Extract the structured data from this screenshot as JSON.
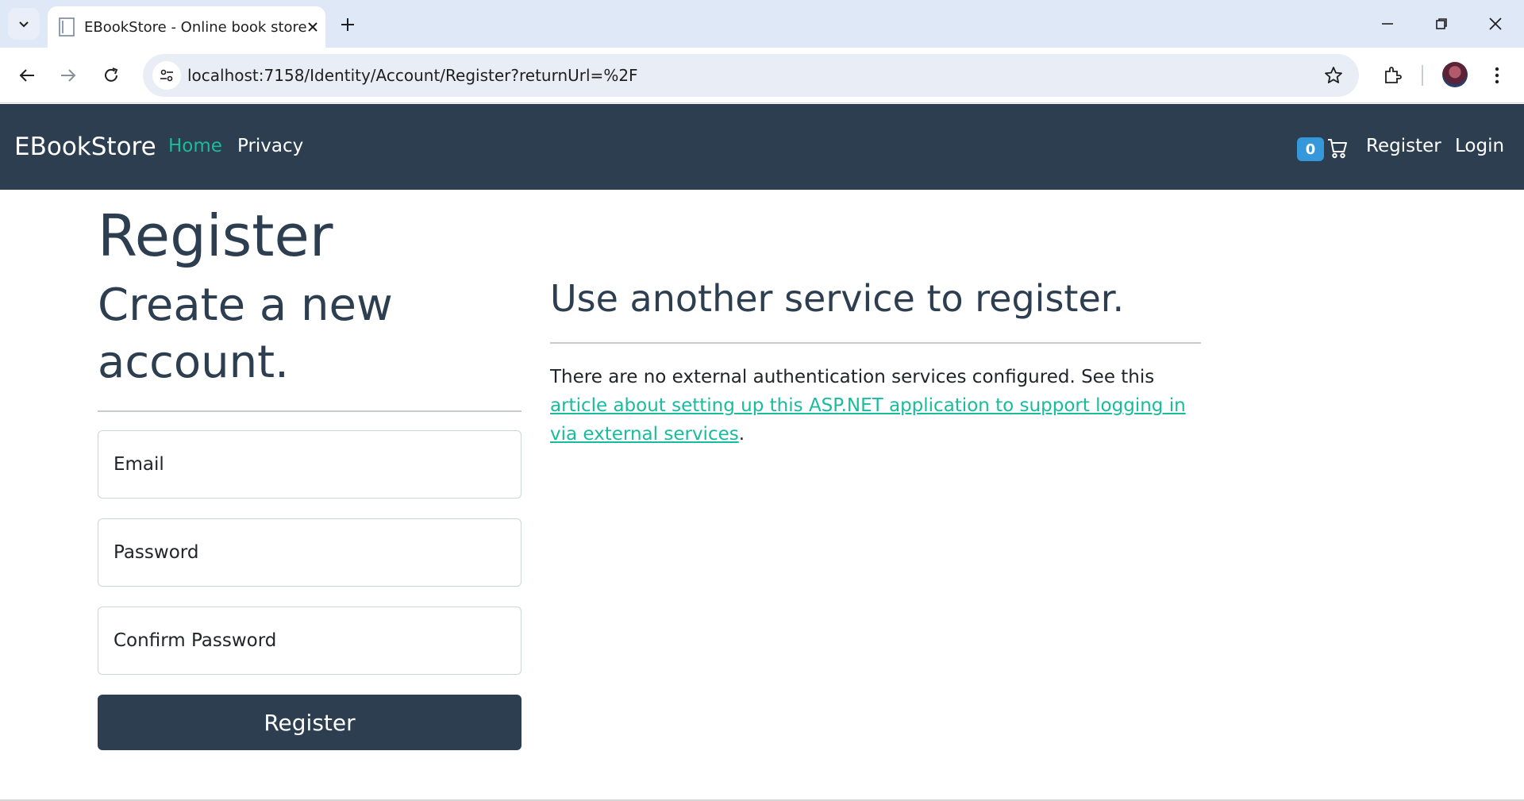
{
  "browser": {
    "tab_title": "EBookStore - Online book store",
    "url": "localhost:7158/Identity/Account/Register?returnUrl=%2F"
  },
  "navbar": {
    "brand": "EBookStore",
    "links": [
      {
        "label": "Home",
        "active": true
      },
      {
        "label": "Privacy",
        "active": false
      }
    ],
    "cart_count": "0",
    "register_label": "Register",
    "login_label": "Login"
  },
  "page": {
    "title": "Register",
    "form_heading": "Create a new account.",
    "fields": [
      {
        "label": "Email"
      },
      {
        "label": "Password"
      },
      {
        "label": "Confirm Password"
      }
    ],
    "submit_label": "Register",
    "external": {
      "heading": "Use another service to register.",
      "text_before": "There are no external authentication services configured. See this ",
      "link_text": "article about setting up this ASP.NET application to support logging in via external services",
      "text_after": "."
    }
  },
  "colors": {
    "navbar_bg": "#2c3e50",
    "accent": "#18bc9c",
    "badge": "#3498db"
  }
}
